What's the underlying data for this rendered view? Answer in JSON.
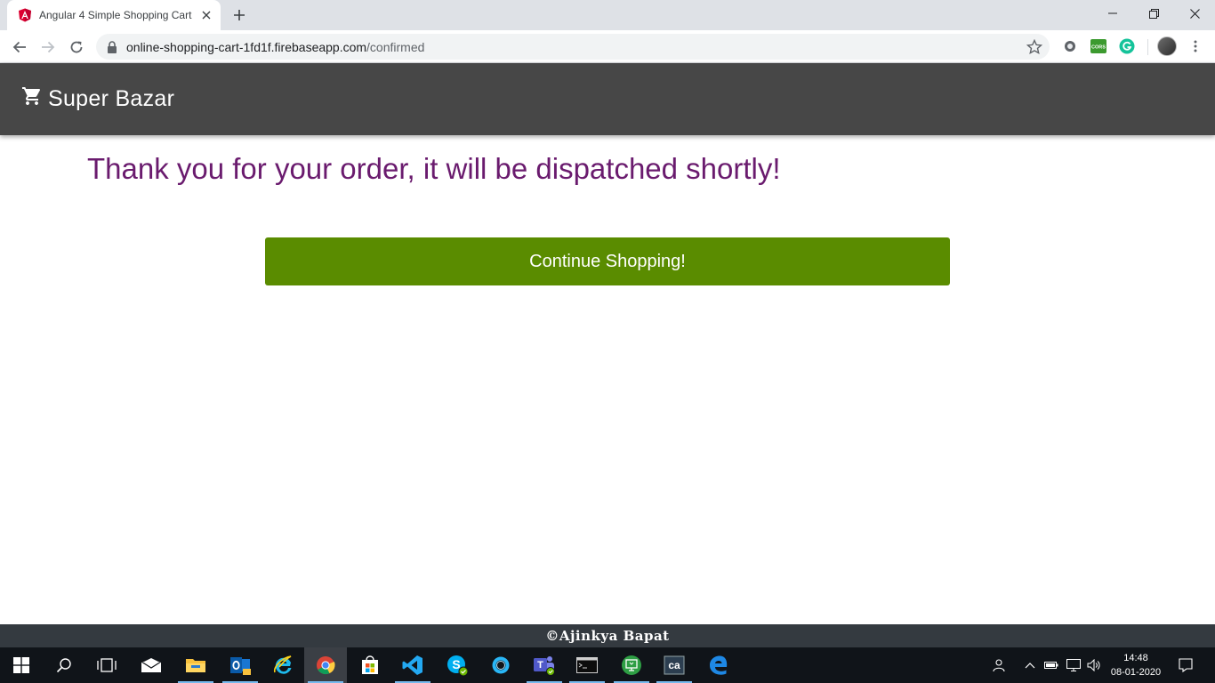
{
  "browser": {
    "tab": {
      "title": "Angular 4 Simple Shopping Cart",
      "favicon": "angular-logo"
    },
    "url": {
      "host": "online-shopping-cart-1fd1f.firebaseapp.com",
      "path": "/confirmed"
    }
  },
  "app": {
    "brand": "Super Bazar",
    "brand_icon": "shopping-cart-icon",
    "message": "Thank you for your order, it will be dispatched shortly!",
    "continue_label": "Continue Shopping!",
    "footer": "©Ajinkya Bapat",
    "colors": {
      "navbar": "#474747",
      "message": "#6a1b6e",
      "button": "#5a8c00",
      "footer": "#343a40"
    }
  },
  "extensions": {
    "cors_label": "CORS"
  },
  "taskbar": {
    "apps": [
      "start",
      "search",
      "task-view",
      "mail",
      "file-explorer",
      "outlook",
      "internet-explorer",
      "chrome",
      "store",
      "vs-code",
      "skype",
      "cortana",
      "teams",
      "terminal",
      "remote-desktop",
      "ca-app",
      "edge"
    ],
    "clock": {
      "time": "14:48",
      "date": "08-01-2020"
    }
  }
}
